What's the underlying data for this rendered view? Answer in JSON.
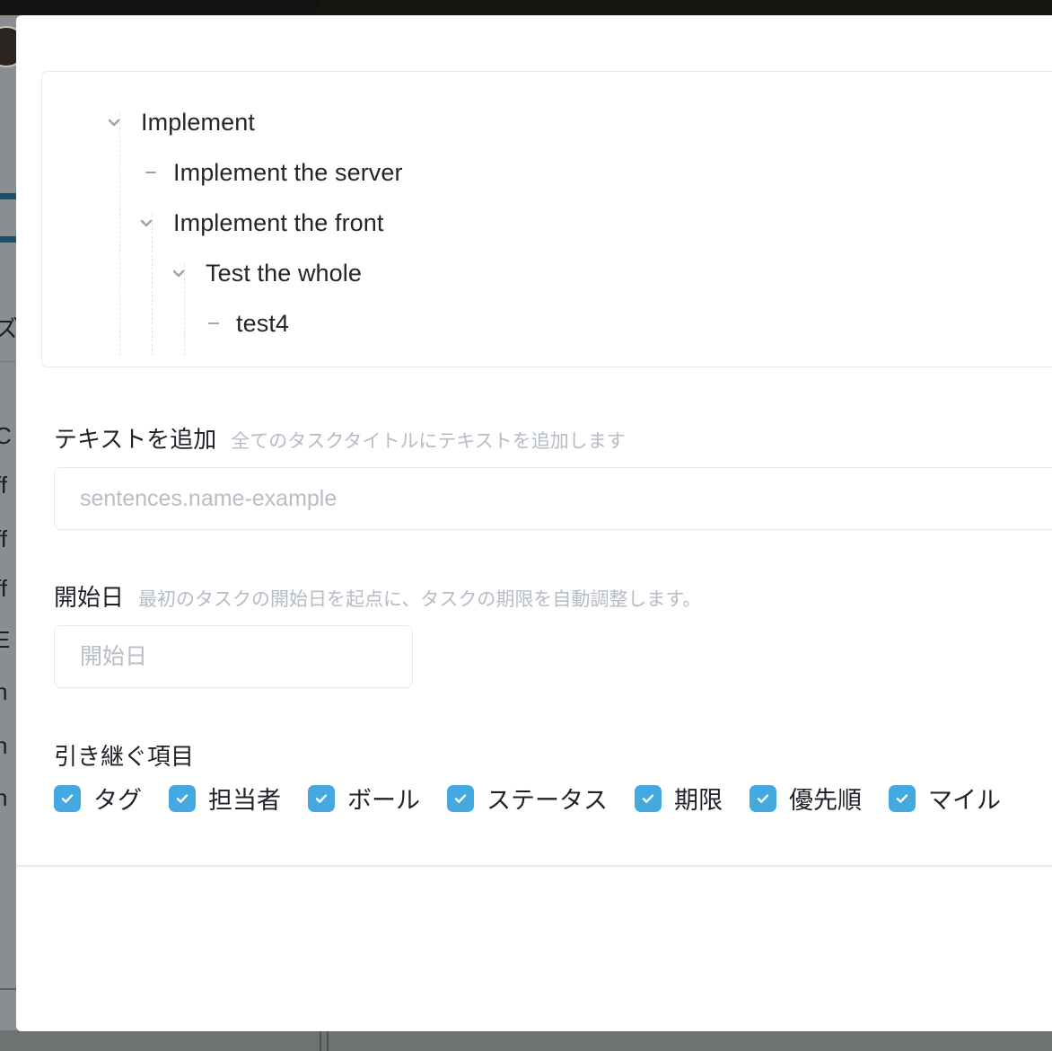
{
  "background": {
    "sidebar_glyphs": [
      "ズ-",
      "C",
      "ff",
      "ff",
      "ff",
      "E",
      "n",
      "n",
      "n"
    ]
  },
  "modal": {
    "tree": {
      "nodes": [
        {
          "label": "Implement",
          "depth": 0,
          "marker": "chevron-down-icon"
        },
        {
          "label": "Implement the server",
          "depth": 1,
          "marker": "dash-icon"
        },
        {
          "label": "Implement the front",
          "depth": 1,
          "marker": "chevron-down-icon"
        },
        {
          "label": "Test the whole",
          "depth": 2,
          "marker": "chevron-down-icon"
        },
        {
          "label": "test4",
          "depth": 3,
          "marker": "dash-icon"
        }
      ]
    },
    "add_text": {
      "title": "テキストを追加",
      "hint": "全てのタスクタイトルにテキストを追加します",
      "value": "",
      "placeholder": "sentences.name-example"
    },
    "start_date": {
      "title": "開始日",
      "hint": "最初のタスクの開始日を起点に、タスクの期限を自動調整します。",
      "value": "",
      "placeholder": "開始日"
    },
    "inherit": {
      "title": "引き継ぐ項目",
      "items": [
        {
          "label": "タグ",
          "checked": true
        },
        {
          "label": "担当者",
          "checked": true
        },
        {
          "label": "ボール",
          "checked": true
        },
        {
          "label": "ステータス",
          "checked": true
        },
        {
          "label": "期限",
          "checked": true
        },
        {
          "label": "優先順",
          "checked": true
        },
        {
          "label": "マイル",
          "checked": true
        }
      ]
    }
  },
  "colors": {
    "accent": "#44a9e0",
    "border": "#e9eaee",
    "text": "#1e2228",
    "hint": "#b6bcc6",
    "tree_marker": "#9aa3ad"
  }
}
